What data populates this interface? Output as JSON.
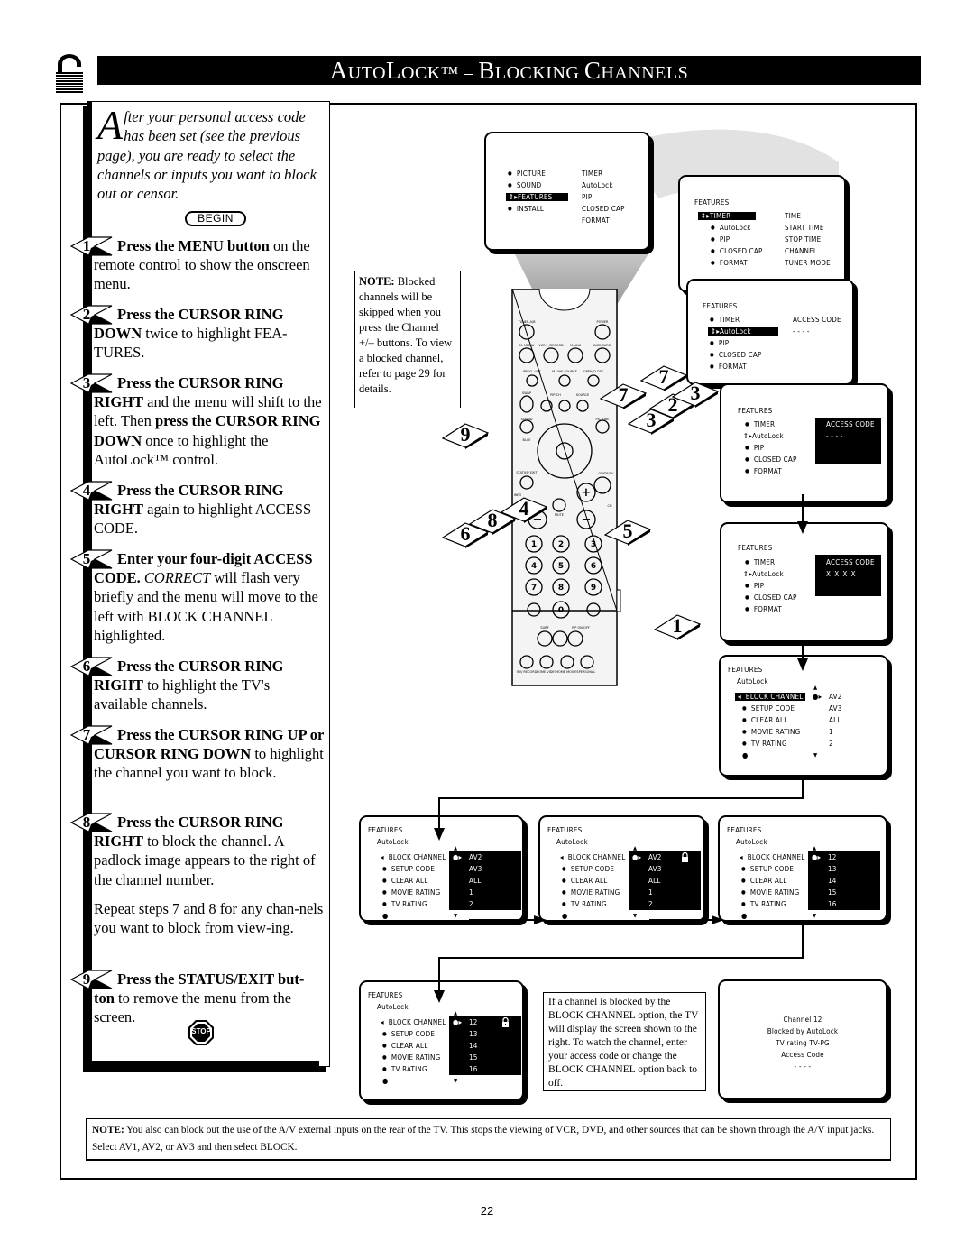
{
  "header": {
    "title_prefix": "A",
    "title_rest_1": "UTO",
    "title_l": "L",
    "title_rest_2": "OCK™ – ",
    "title_b": "B",
    "title_rest_3": "LOCKING ",
    "title_c": "C",
    "title_rest_4": "HANNELS",
    "title": "AutoLock™ – Blocking Channels",
    "lock_icon": "padlock-icon"
  },
  "intro": {
    "dropcap": "A",
    "text": "fter your personal access code has been set (see the previous page), you are ready to select the channels or inputs you want to block out or censor.",
    "begin_label": "BEGIN"
  },
  "steps": [
    {
      "num": "1",
      "bold": "Press the MENU button",
      "rest": " on the remote control to show the onscreen menu."
    },
    {
      "num": "2",
      "bold": "Press the CURSOR RING DOWN",
      "rest": " twice to highlight FEA-TURES."
    },
    {
      "num": "3",
      "bold": "Press the CURSOR RING RIGHT",
      "rest": " and the menu will shift to the left. Then ",
      "bold2": "press the CURSOR RING DOWN",
      "rest2": " once to highlight the AutoLock™ control."
    },
    {
      "num": "4",
      "bold": "Press the CURSOR RING RIGHT",
      "rest": " again to highlight ACCESS CODE."
    },
    {
      "num": "5",
      "bold": "Enter your four-digit ACCESS CODE.",
      "italic": " CORRECT",
      "rest": " will flash very briefly and the menu will move to the left with BLOCK CHANNEL highlighted."
    },
    {
      "num": "6",
      "bold": "Press the CURSOR RING RIGHT",
      "rest": " to highlight the TV's available channels."
    },
    {
      "num": "7",
      "bold": "Press the CURSOR RING UP or CURSOR RING DOWN",
      "rest": " to highlight the channel you want to block."
    },
    {
      "num": "8",
      "bold": "Press the CURSOR RING RIGHT",
      "rest": " to block the channel.  A padlock image appears to the right of the channel number.",
      "extra": "Repeat steps 7 and 8 for any chan-nels you want to block from view-ing."
    },
    {
      "num": "9",
      "bold": "Press the STATUS/EXIT but-ton",
      "rest": " to remove the menu from the screen.",
      "stop_label": "STOP"
    }
  ],
  "note_remote": {
    "label": "NOTE:",
    "text": " Blocked channels will be skipped when you press the Channel +/– buttons.  To view a blocked channel, refer to page 29 for details."
  },
  "main_menu": {
    "left": [
      "PICTURE",
      "SOUND",
      "FEATURES",
      "INSTALL"
    ],
    "selected": "FEATURES",
    "right": [
      "TIMER",
      "AutoLock",
      "PIP",
      "CLOSED CAP",
      "FORMAT"
    ]
  },
  "features_menu_1": {
    "title": "FEATURES",
    "left": [
      "TIMER",
      "AutoLock",
      "PIP",
      "CLOSED CAP",
      "FORMAT"
    ],
    "selected": "TIMER",
    "right": [
      "TIME",
      "START TIME",
      "STOP TIME",
      "CHANNEL",
      "TUNER MODE"
    ]
  },
  "features_menu_2": {
    "title": "FEATURES",
    "left": [
      "TIMER",
      "AutoLock",
      "PIP",
      "CLOSED CAP",
      "FORMAT"
    ],
    "selected": "AutoLock",
    "right_title": "ACCESS CODE",
    "right_value": "- - - -"
  },
  "features_menu_3": {
    "title": "FEATURES",
    "left": [
      "TIMER",
      "AutoLock",
      "PIP",
      "CLOSED CAP",
      "FORMAT"
    ],
    "right_title": "ACCESS CODE",
    "right_value": "- - - -"
  },
  "features_menu_4": {
    "title": "FEATURES",
    "left": [
      "TIMER",
      "AutoLock",
      "PIP",
      "CLOSED CAP",
      "FORMAT"
    ],
    "right_title": "ACCESS CODE",
    "right_value": "X X X X"
  },
  "autolock_menus": [
    {
      "title": "FEATURES",
      "subtitle": "AutoLock",
      "items": [
        "BLOCK CHANNEL",
        "SETUP CODE",
        "CLEAR ALL",
        "MOVIE RATING",
        "TV RATING"
      ],
      "values": [
        "AV2",
        "AV3",
        "ALL",
        "1",
        "2"
      ],
      "values_highlighted": false,
      "locked": false
    },
    {
      "title": "FEATURES",
      "subtitle": "AutoLock",
      "items": [
        "BLOCK CHANNEL",
        "SETUP CODE",
        "CLEAR ALL",
        "MOVIE RATING",
        "TV RATING"
      ],
      "values": [
        "AV2",
        "AV3",
        "ALL",
        "1",
        "2"
      ],
      "values_highlighted": true,
      "locked": false
    },
    {
      "title": "FEATURES",
      "subtitle": "AutoLock",
      "items": [
        "BLOCK CHANNEL",
        "SETUP CODE",
        "CLEAR ALL",
        "MOVIE RATING",
        "TV RATING"
      ],
      "values": [
        "AV2",
        "AV3",
        "ALL",
        "1",
        "2"
      ],
      "values_highlighted": true,
      "locked": true
    },
    {
      "title": "FEATURES",
      "subtitle": "AutoLock",
      "items": [
        "BLOCK CHANNEL",
        "SETUP CODE",
        "CLEAR ALL",
        "MOVIE RATING",
        "TV RATING"
      ],
      "values": [
        "12",
        "13",
        "14",
        "15",
        "16"
      ],
      "values_highlighted": true,
      "locked": false
    },
    {
      "title": "FEATURES",
      "subtitle": "AutoLock",
      "items": [
        "BLOCK CHANNEL",
        "SETUP CODE",
        "CLEAR ALL",
        "MOVIE RATING",
        "TV RATING"
      ],
      "values": [
        "12",
        "13",
        "14",
        "15",
        "16"
      ],
      "values_highlighted": true,
      "locked": true
    }
  ],
  "blocked_note": "If a channel is blocked by the BLOCK CHANNEL option, the TV will display the screen shown to the right. To watch the channel, enter your access code or change the BLOCK CHANNEL option back to off.",
  "blocked_screen": [
    "Channel  12",
    "Blocked  by AutoLock",
    "TV rating  TV-PG",
    "Access  Code",
    "- - - -"
  ],
  "remote": {
    "labels": [
      "TUNER A/B",
      "POWER",
      "M. MEDIA",
      "VCR+ /RECORD",
      "M-LINK",
      "INCR. SURR.",
      "PROG. LIST",
      "M-LINK SOURCE",
      "OPEN/CLOSE",
      "OK",
      "SWAP",
      "PIP CH",
      "SOURCE",
      "DN",
      "UP",
      "SOUND",
      "PICTURE",
      "BLUE",
      "STATUS/ EXIT",
      "GUIDE/TV",
      "INFO",
      "MUTE",
      "CH",
      "SURF",
      "PIP ON/OFF",
      "ITV/ RECORD",
      "HOME VIDEO",
      "HOME MOVIES",
      "PERSONAL",
      "A/CH",
      "CC"
    ],
    "keypad": [
      "1",
      "2",
      "3",
      "4",
      "5",
      "6",
      "7",
      "8",
      "9",
      "0"
    ],
    "callouts": [
      "9",
      "7",
      "3",
      "2",
      "7",
      "3",
      "4",
      "8",
      "6",
      "5",
      "1"
    ]
  },
  "bottom_note": {
    "label": "NOTE:",
    "text": "  You also can block out the use of the A/V external inputs on the rear of the TV.  This stops the viewing of VCR, DVD, and other sources that can be shown through the A/V input jacks. Select AV1, AV2, or AV3 and then select BLOCK."
  },
  "page_number": "22"
}
